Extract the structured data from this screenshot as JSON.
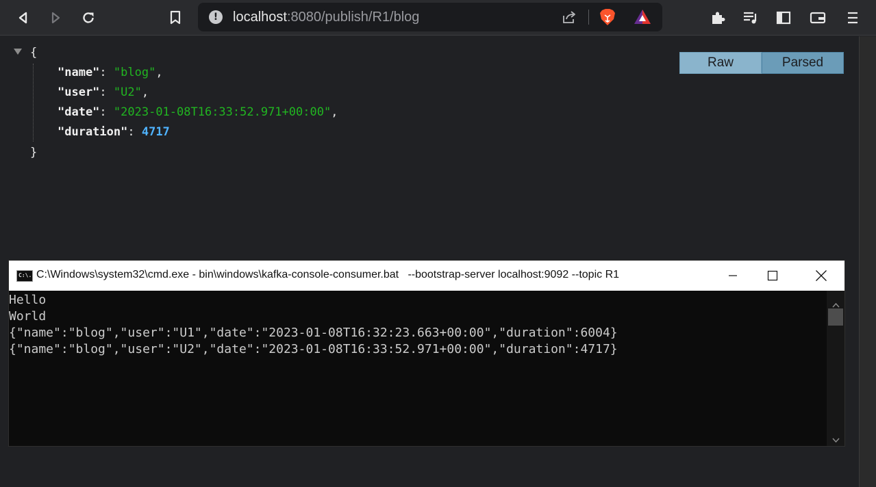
{
  "browser": {
    "url_host": "localhost",
    "url_rest": ":8080/publish/R1/blog",
    "icons": [
      "back-icon",
      "forward-icon",
      "reload-icon",
      "bookmark-icon",
      "site-info-icon",
      "share-icon",
      "brave-shields-icon",
      "brave-rewards-icon",
      "extensions-icon",
      "playlist-icon",
      "sidebar-icon",
      "wallet-icon",
      "menu-icon"
    ]
  },
  "json_viewer": {
    "open_brace": "{",
    "close_brace": "}",
    "fields": [
      {
        "key": "\"name\"",
        "value": "\"blog\"",
        "type": "string",
        "comma": ","
      },
      {
        "key": "\"user\"",
        "value": "\"U2\"",
        "type": "string",
        "comma": ","
      },
      {
        "key": "\"date\"",
        "value": "\"2023-01-08T16:33:52.971+00:00\"",
        "type": "string",
        "comma": ","
      },
      {
        "key": "\"duration\"",
        "value": "4717",
        "type": "number",
        "comma": ""
      }
    ],
    "toggle": {
      "raw_label": "Raw",
      "parsed_label": "Parsed",
      "selected": "Parsed"
    }
  },
  "cmd_window": {
    "icon_label": "C:\\.",
    "title": "C:\\Windows\\system32\\cmd.exe - bin\\windows\\kafka-console-consumer.bat   --bootstrap-server localhost:9092 --topic R1",
    "lines": [
      "Hello",
      "World",
      "{\"name\":\"blog\",\"user\":\"U1\",\"date\":\"2023-01-08T16:32:23.663+00:00\",\"duration\":6004}",
      "{\"name\":\"blog\",\"user\":\"U2\",\"date\":\"2023-01-08T16:33:52.971+00:00\",\"duration\":4717}"
    ]
  },
  "colors": {
    "json_string": "#21b521",
    "json_number": "#4fb3ff",
    "toggle_raw": "#8ab4cc",
    "toggle_parsed": "#6b9cb8"
  }
}
